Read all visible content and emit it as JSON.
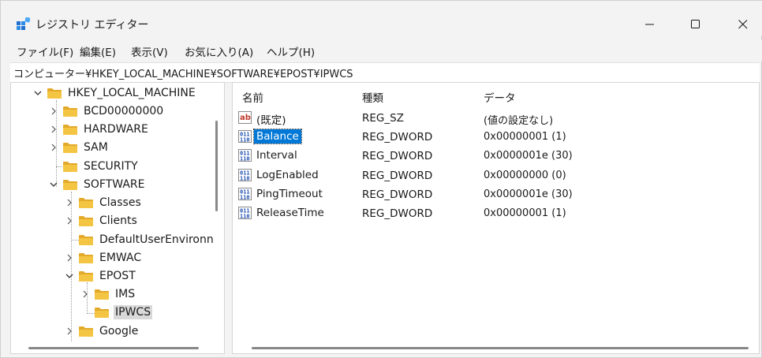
{
  "window": {
    "title": "レジストリ エディター",
    "controls": {
      "minimize": "—",
      "maximize": "☐",
      "close": "✕"
    }
  },
  "menu": [
    "ファイル(F)",
    "編集(E)",
    "表示(V)",
    "お気に入り(A)",
    "ヘルプ(H)"
  ],
  "address": "コンピューター¥HKEY_LOCAL_MACHINE¥SOFTWARE¥EPOST¥IPWCS",
  "tree": {
    "items": [
      {
        "label": "HKEY_LOCAL_MACHINE",
        "expanded": true
      },
      {
        "label": "BCD00000000"
      },
      {
        "label": "HARDWARE"
      },
      {
        "label": "SAM"
      },
      {
        "label": "SECURITY"
      },
      {
        "label": "SOFTWARE",
        "expanded": true
      },
      {
        "label": "Classes"
      },
      {
        "label": "Clients"
      },
      {
        "label": "DefaultUserEnvironn"
      },
      {
        "label": "EMWAC"
      },
      {
        "label": "EPOST",
        "expanded": true
      },
      {
        "label": "IMS"
      },
      {
        "label": "IPWCS",
        "selected": true
      },
      {
        "label": "Google"
      }
    ]
  },
  "list": {
    "columns": [
      "名前",
      "種類",
      "データ"
    ],
    "rows": [
      {
        "icon": "string-value-icon",
        "name": "(既定)",
        "type": "REG_SZ",
        "data": "(値の設定なし)"
      },
      {
        "icon": "dword-value-icon",
        "name": "Balance",
        "type": "REG_DWORD",
        "data": "0x00000001 (1)",
        "selected": true
      },
      {
        "icon": "dword-value-icon",
        "name": "Interval",
        "type": "REG_DWORD",
        "data": "0x0000001e (30)"
      },
      {
        "icon": "dword-value-icon",
        "name": "LogEnabled",
        "type": "REG_DWORD",
        "data": "0x00000000 (0)"
      },
      {
        "icon": "dword-value-icon",
        "name": "PingTimeout",
        "type": "REG_DWORD",
        "data": "0x0000001e (30)"
      },
      {
        "icon": "dword-value-icon",
        "name": "ReleaseTime",
        "type": "REG_DWORD",
        "data": "0x00000001 (1)"
      }
    ]
  },
  "colors": {
    "selection": "#0078d7",
    "folder": "#f4c542",
    "folder_dark": "#e3a92a"
  }
}
